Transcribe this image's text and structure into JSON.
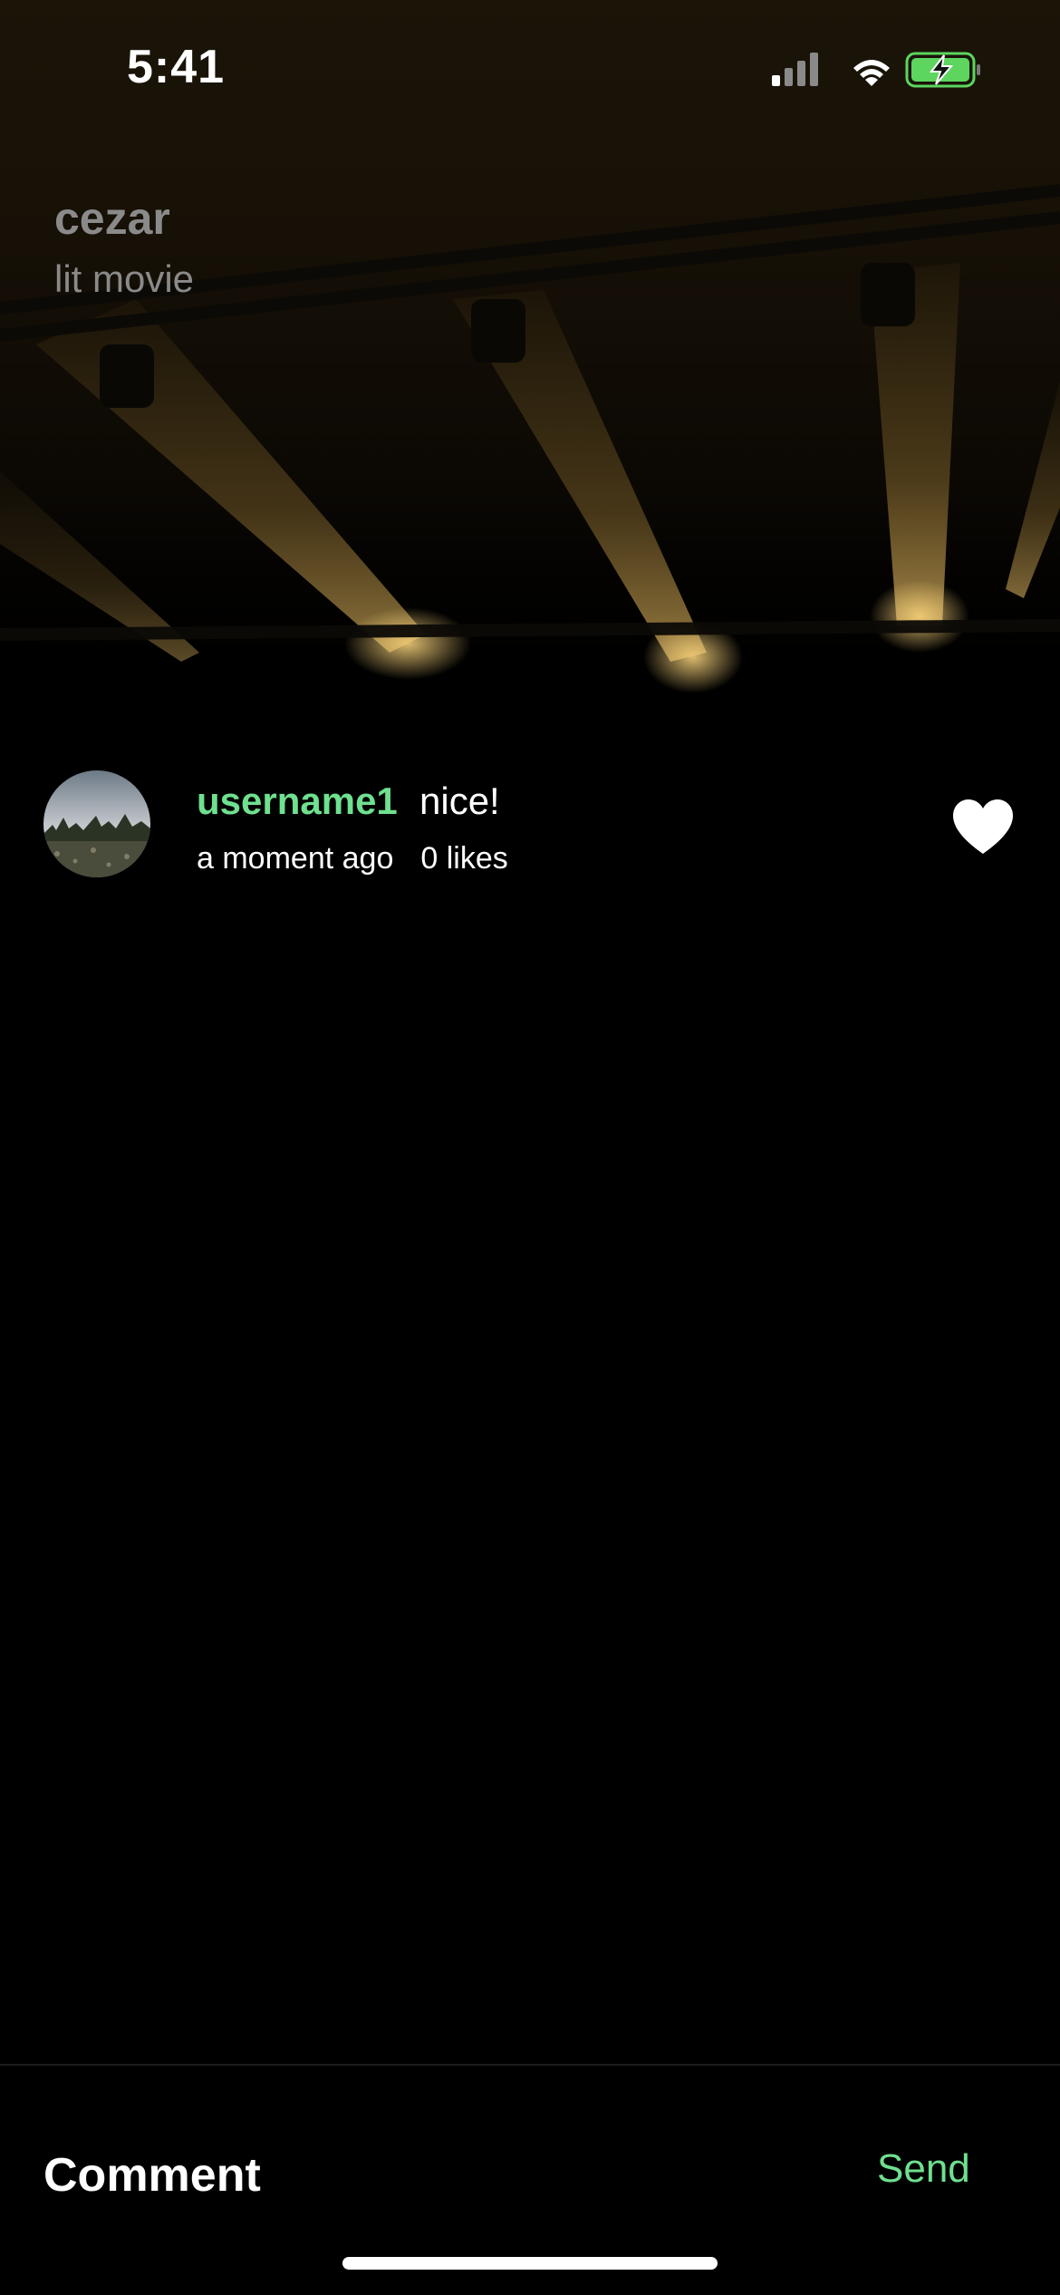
{
  "status_bar": {
    "time": "5:41",
    "icons": [
      "cellular-signal-icon",
      "wifi-icon",
      "battery-charging-icon"
    ],
    "battery_color": "#5dd55f"
  },
  "post": {
    "author": "cezar",
    "caption": "lit movie"
  },
  "comments": [
    {
      "username": "username1",
      "text": "nice!",
      "time": "a moment ago",
      "likes": "0 likes",
      "liked": true
    }
  ],
  "composer": {
    "placeholder": "Comment",
    "send_label": "Send"
  },
  "colors": {
    "accent": "#6ee08f",
    "background": "#000000",
    "muted_text": "#8a8a8a"
  }
}
